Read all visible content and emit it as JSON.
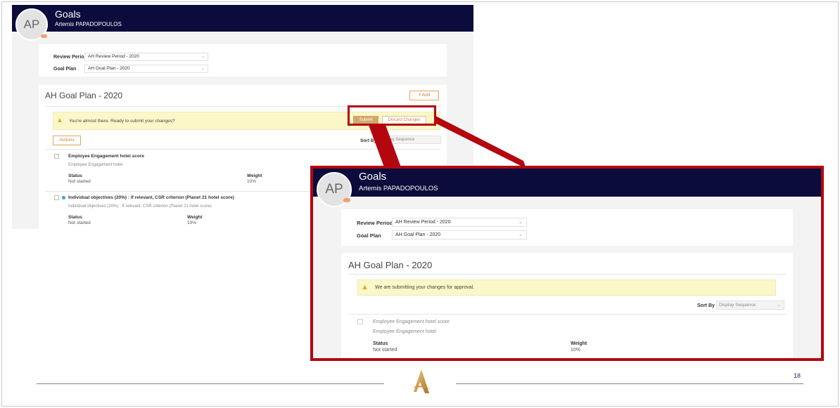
{
  "screen1": {
    "title": "Goals",
    "user": "Artemis PAPADOPOULOS",
    "avatar_initials": "AP",
    "review_period_label": "Review Period",
    "review_period_value": "AH Review Period - 2020",
    "goal_plan_label": "Goal Plan",
    "goal_plan_value": "AH Goal Plan - 2020",
    "plan_title": "AH Goal Plan - 2020",
    "add_label": "Add",
    "warning_message": "You're almost there. Ready to submit your changes?",
    "submit_label": "Submit",
    "discard_label": "Discard Changes",
    "actions_label": "Actions",
    "sort_by_label": "Sort By",
    "sort_by_value": "Display Sequence",
    "goals": [
      {
        "title": "Employee Engagement hotel score",
        "subtitle": "Employee Engagement hotel",
        "status_label": "Status",
        "status_value": "Not started",
        "weight_label": "Weight",
        "weight_value": "10%"
      },
      {
        "title": "Individual objectives (20%) : If relevant, CSR criterion (Planet 21 hotel score)",
        "subtitle": "Individual objectives (20%) : If relevant, CSR criterion (Planet 21 hotel score)",
        "status_label": "Status",
        "status_value": "Not started",
        "weight_label": "Weight",
        "weight_value": "10%"
      }
    ]
  },
  "screen2": {
    "title": "Goals",
    "user": "Artemis PAPADOPOULOS",
    "avatar_initials": "AP",
    "review_period_label": "Review Period",
    "review_period_value": "AH Review Period - 2020",
    "goal_plan_label": "Goal Plan",
    "goal_plan_value": "AH Goal Plan - 2020",
    "plan_title": "AH Goal Plan - 2020",
    "warning_message": "We are submitting your changes for approval.",
    "sort_by_label": "Sort By",
    "sort_by_value": "Display Sequence",
    "goal": {
      "title": "Employee Engagement hotel score",
      "subtitle": "Employee Engagement hotel",
      "status_label": "Status",
      "status_value": "Not started",
      "weight_label": "Weight",
      "weight_value": "10%"
    }
  },
  "footer": {
    "page_number": "18"
  },
  "colors": {
    "header_bg": "#0b0c3b",
    "highlight_red": "#b3060f",
    "accent_gold": "#d2a86a",
    "warning_bg": "#fbf7c8"
  }
}
